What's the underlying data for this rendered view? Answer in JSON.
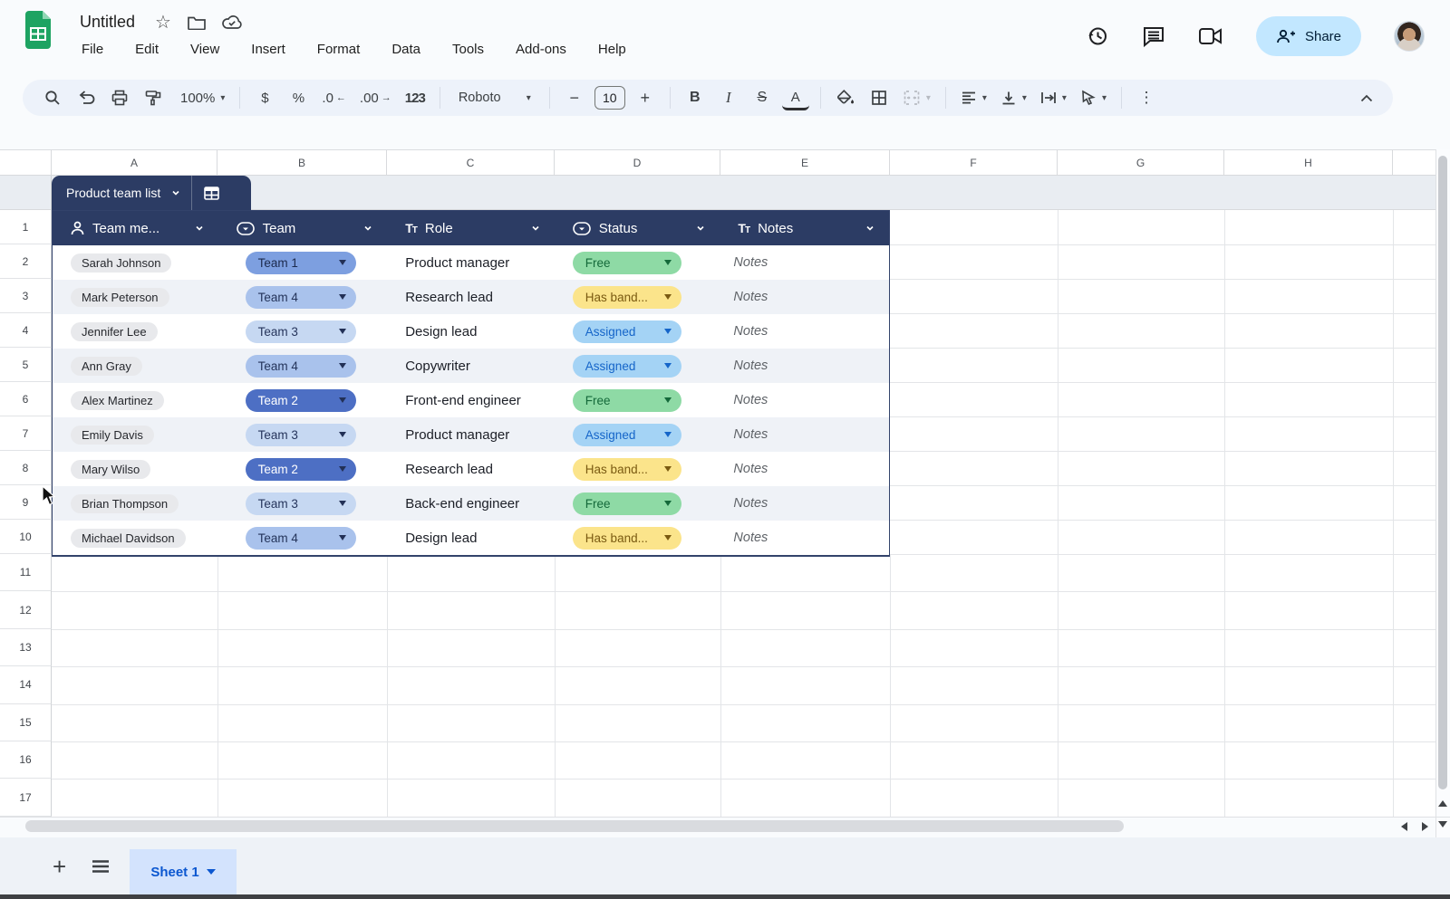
{
  "app": {
    "title": "Untitled",
    "menus": [
      "File",
      "Edit",
      "View",
      "Insert",
      "Format",
      "Data",
      "Tools",
      "Add-ons",
      "Help"
    ],
    "share_label": "Share"
  },
  "toolbar": {
    "zoom": "100%",
    "currency": "$",
    "percent": "%",
    "decrease_decimal": ".0",
    "increase_decimal": ".00",
    "more_formats": "123",
    "font_name": "Roboto",
    "font_size": "10",
    "minus": "−",
    "plus": "+",
    "bold": "B",
    "italic": "I",
    "strikethrough": "S",
    "text_color": "A",
    "more": "⋮"
  },
  "grid": {
    "columns": [
      "A",
      "B",
      "C",
      "D",
      "E",
      "F",
      "G",
      "H"
    ],
    "row_numbers": [
      "1",
      "2",
      "3",
      "4",
      "5",
      "6",
      "7",
      "8",
      "9",
      "10",
      "11",
      "12",
      "13",
      "14",
      "15",
      "16",
      "17"
    ]
  },
  "table": {
    "name": "Product team list",
    "headers": [
      {
        "label": "Team me...",
        "icon": "person-icon"
      },
      {
        "label": "Team",
        "icon": "dropdown-chip-icon"
      },
      {
        "label": "Role",
        "icon": "text-type-icon"
      },
      {
        "label": "Status",
        "icon": "dropdown-chip-icon"
      },
      {
        "label": "Notes",
        "icon": "text-type-icon"
      }
    ],
    "rows": [
      {
        "name": "Sarah Johnson",
        "team": "Team 1",
        "role": "Product manager",
        "status": "Free",
        "notes": "Notes"
      },
      {
        "name": "Mark Peterson",
        "team": "Team 4",
        "role": "Research lead",
        "status": "Has band...",
        "notes": "Notes"
      },
      {
        "name": "Jennifer Lee",
        "team": "Team 3",
        "role": "Design lead",
        "status": "Assigned",
        "notes": "Notes"
      },
      {
        "name": "Ann Gray",
        "team": "Team 4",
        "role": "Copywriter",
        "status": "Assigned",
        "notes": "Notes"
      },
      {
        "name": "Alex Martinez",
        "team": "Team 2",
        "role": "Front-end engineer",
        "status": "Free",
        "notes": "Notes"
      },
      {
        "name": "Emily Davis",
        "team": "Team 3",
        "role": "Product manager",
        "status": "Assigned",
        "notes": "Notes"
      },
      {
        "name": "Mary Wilso",
        "team": "Team 2",
        "role": "Research lead",
        "status": "Has band...",
        "notes": "Notes"
      },
      {
        "name": "Brian Thompson",
        "team": "Team 3",
        "role": "Back-end engineer",
        "status": "Free",
        "notes": "Notes"
      },
      {
        "name": "Michael Davidson",
        "team": "Team 4",
        "role": "Design lead",
        "status": "Has band...",
        "notes": "Notes"
      }
    ]
  },
  "sheet_bar": {
    "active_tab": "Sheet 1"
  },
  "colors": {
    "table_header_navy": "#2c3c64",
    "team1_bg": "#7d9fe0",
    "team2_bg": "#4d6fc4",
    "team3_bg": "#c6d8f2",
    "team4_bg": "#a9c2ec",
    "status_free_bg": "#8edaa5",
    "status_free_text": "#14693a",
    "status_has_bandwidth_bg": "#fbe48b",
    "status_has_bandwidth_text": "#7a5a11",
    "status_assigned_bg": "#a4d3f5",
    "status_assigned_text": "#1565c9",
    "name_chip_bg": "#e8e9ec",
    "share_button_bg": "#c2e7ff",
    "active_sheet_tab_bg": "#d3e3fd",
    "link_blue": "#0b57d0",
    "sheets_green": "#1ea362"
  }
}
